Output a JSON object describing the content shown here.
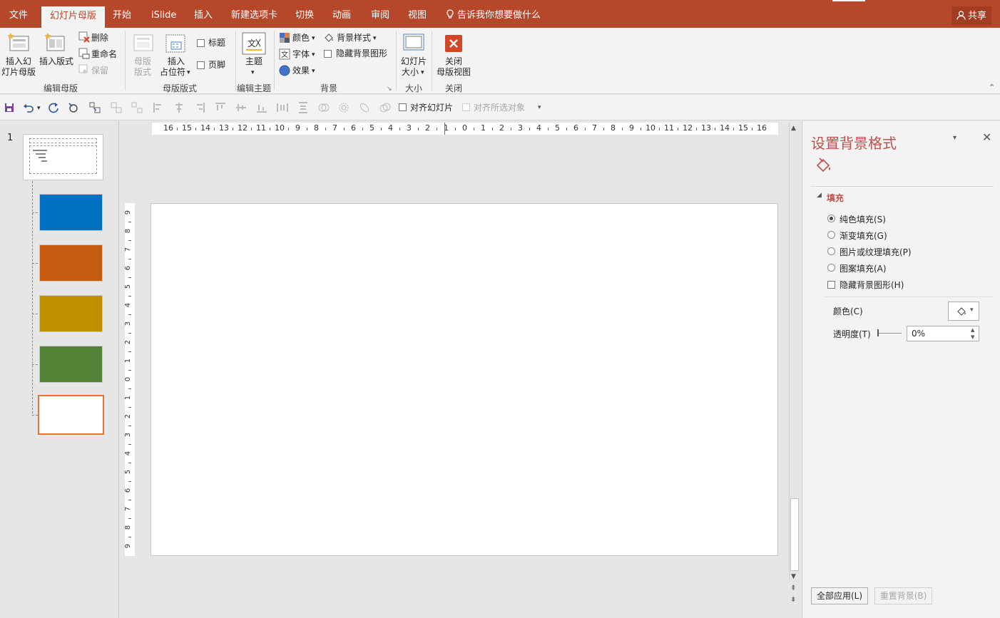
{
  "tabs": [
    {
      "id": "file",
      "label": "文件",
      "active": false
    },
    {
      "id": "slide-master",
      "label": "幻灯片母版",
      "active": true
    },
    {
      "id": "home",
      "label": "开始",
      "active": false
    },
    {
      "id": "islide",
      "label": "iSlide",
      "active": false
    },
    {
      "id": "insert",
      "label": "插入",
      "active": false
    },
    {
      "id": "new-tab",
      "label": "新建选项卡",
      "active": false
    },
    {
      "id": "transitions",
      "label": "切换",
      "active": false
    },
    {
      "id": "animations",
      "label": "动画",
      "active": false
    },
    {
      "id": "review",
      "label": "审阅",
      "active": false
    },
    {
      "id": "view",
      "label": "视图",
      "active": false
    }
  ],
  "tell_me": "告诉我你想要做什么",
  "share": "共享",
  "ribbon": {
    "edit_master": {
      "group": "编辑母版",
      "insert_master_l1": "插入幻",
      "insert_master_l2": "灯片母版",
      "insert_layout": "插入版式",
      "delete": "删除",
      "rename": "重命名",
      "preserve": "保留"
    },
    "master_layout": {
      "group": "母版版式",
      "master_layout_l1": "母版",
      "master_layout_l2": "版式",
      "insert_placeholder_l1": "插入",
      "insert_placeholder_l2": "占位符",
      "title": "标题",
      "footer": "页脚"
    },
    "edit_theme": {
      "group": "编辑主题",
      "themes": "主题"
    },
    "background": {
      "group": "背景",
      "colors": "颜色",
      "fonts": "字体",
      "effects": "效果",
      "background_styles": "背景样式",
      "hide_bg_graphics": "隐藏背景图形"
    },
    "size": {
      "group": "大小",
      "slide_size_l1": "幻灯片",
      "slide_size_l2": "大小"
    },
    "close": {
      "group": "关闭",
      "close_l1": "关闭",
      "close_l2": "母版视图"
    }
  },
  "qat": {
    "align_slide": "对齐幻灯片",
    "align_selected": "对齐所选对象"
  },
  "slide_panel": {
    "slide_number": "1",
    "layouts": [
      {
        "name": "blue",
        "color": "#0070c0"
      },
      {
        "name": "orange",
        "color": "#c55a11"
      },
      {
        "name": "gold",
        "color": "#bf9000"
      },
      {
        "name": "green",
        "color": "#538135"
      },
      {
        "name": "white",
        "color": "#ffffff",
        "selected": true
      }
    ]
  },
  "ruler": {
    "h_ticks": [
      "16",
      "15",
      "14",
      "13",
      "12",
      "11",
      "10",
      "9",
      "8",
      "7",
      "6",
      "5",
      "4",
      "3",
      "2",
      "1",
      "0",
      "1",
      "2",
      "3",
      "4",
      "5",
      "6",
      "7",
      "8",
      "9",
      "10",
      "11",
      "12",
      "13",
      "14",
      "15",
      "16"
    ],
    "v_ticks": [
      "9",
      "8",
      "7",
      "6",
      "5",
      "4",
      "3",
      "2",
      "1",
      "0",
      "1",
      "2",
      "3",
      "4",
      "5",
      "6",
      "7",
      "8",
      "9"
    ]
  },
  "pane": {
    "title": "设置背景格式",
    "section": "填充",
    "options": [
      {
        "id": "solid",
        "label": "纯色填充(S)",
        "checked": true
      },
      {
        "id": "gradient",
        "label": "渐变填充(G)",
        "checked": false
      },
      {
        "id": "picture",
        "label": "图片或纹理填充(P)",
        "checked": false
      },
      {
        "id": "pattern",
        "label": "图案填充(A)",
        "checked": false
      }
    ],
    "hide_bg": "隐藏背景图形(H)",
    "color_label": "颜色(C)",
    "transparency_label": "透明度(T)",
    "transparency_value": "0%",
    "apply_all": "全部应用(L)",
    "reset_bg": "重置背景(B)"
  },
  "colors": {
    "accent": "#b7472a",
    "pane_title": "#c0504d"
  }
}
